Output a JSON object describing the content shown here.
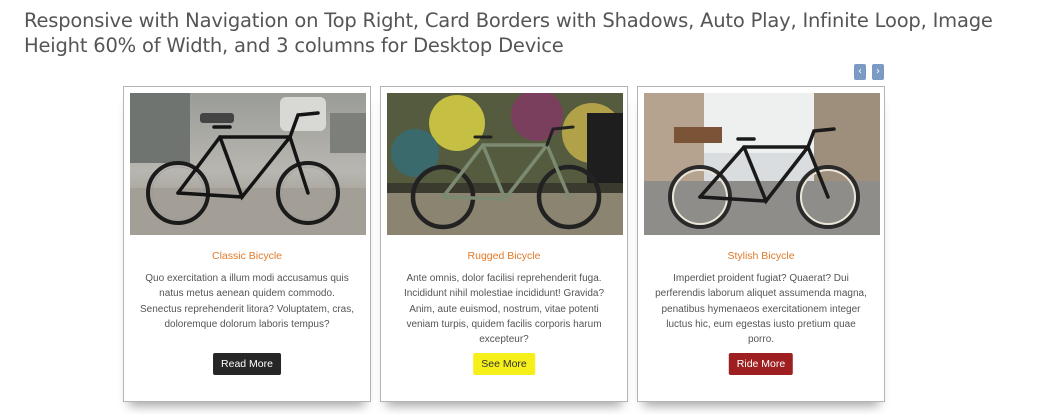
{
  "heading": "Responsive with Navigation on Top Right, Card Borders with Shadows, Auto Play, Infinite Loop, Image Height 60% of Width, and 3 columns for Desktop Device",
  "nav": {
    "prev_icon": "chevron-left-icon",
    "prev_label": "‹",
    "next_icon": "chevron-right-icon",
    "next_label": "›",
    "color": "#7c9bc4"
  },
  "cards": [
    {
      "title": "Classic Bicycle",
      "text": "Quo exercitation a illum modi accusamus quis natus metus aenean quidem commodo. Senectus reprehenderit litora? Voluptatem, cras, doloremque dolorum laboris tempus?",
      "button_label": "Read More",
      "button_bg": "#262626",
      "button_fg": "#ffffff"
    },
    {
      "title": "Rugged Bicycle",
      "text": "Ante omnis, dolor facilisi reprehenderit fuga. Incididunt nihil molestiae incididunt! Gravida? Anim, aute euismod, nostrum, vitae potenti veniam turpis, quidem facilis corporis harum excepteur?",
      "button_label": "See More",
      "button_bg": "#f5ef1a",
      "button_fg": "#333333"
    },
    {
      "title": "Stylish Bicycle",
      "text": "Imperdiet proident fugiat? Quaerat? Dui perferendis laborum aliquet assumenda magna, penatibus hymenaeos exercitationem integer luctus hic, eum egestas iusto pretium quae porro.",
      "button_label": "Ride More",
      "button_bg": "#9e1f1f",
      "button_fg": "#ffffff"
    }
  ],
  "colors": {
    "title": "#e07a2a",
    "text": "#555555",
    "heading": "#555555",
    "card_border": "#b4b4b4"
  }
}
